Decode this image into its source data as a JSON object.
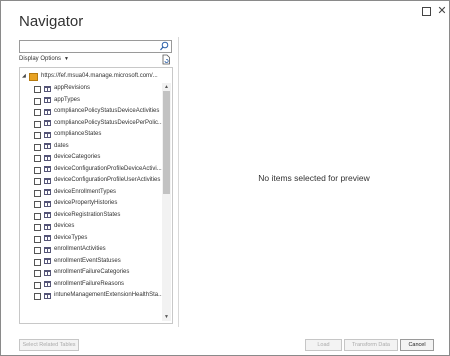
{
  "window": {
    "title": "Navigator"
  },
  "search": {
    "placeholder": ""
  },
  "display_options": {
    "label": "Display Options"
  },
  "tree": {
    "root_label": "https://fef.msua04.manage.microsoft.com/...",
    "items": [
      "appRevisions",
      "appTypes",
      "compliancePolicyStatusDeviceActivities",
      "compliancePolicyStatusDevicePerPolic...",
      "complianceStates",
      "dates",
      "deviceCategories",
      "deviceConfigurationProfileDeviceActivi...",
      "deviceConfigurationProfileUserActivities",
      "deviceEnrollmentTypes",
      "devicePropertyHistories",
      "deviceRegistrationStates",
      "devices",
      "deviceTypes",
      "enrollmentActivities",
      "enrollmentEventStatuses",
      "enrollmentFailureCategories",
      "enrollmentFailureReasons",
      "intuneManagementExtensionHealthSta..."
    ]
  },
  "preview": {
    "message": "No items selected for preview"
  },
  "buttons": {
    "select_related": "Select Related Tables",
    "load": "Load",
    "transform": "Transform Data",
    "cancel": "Cancel"
  }
}
